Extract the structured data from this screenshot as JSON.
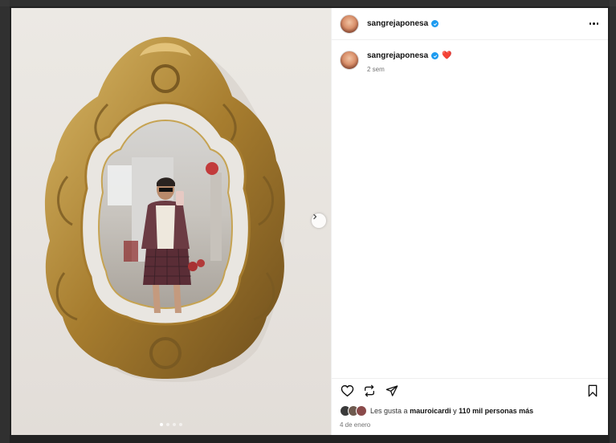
{
  "post": {
    "username": "sangrejaponesa",
    "caption_emoji": "❤️",
    "time_ago": "2 sem",
    "likes_prefix": "Les gusta a",
    "likes_user": "mauroicardi",
    "likes_conj": "y",
    "likes_count": "110 mil personas más",
    "date": "4 de enero"
  },
  "carousel": {
    "total": 4,
    "active": 1
  },
  "colors": {
    "verified": "#1d9bf0",
    "heart": "#e0245e",
    "mirror_frame": "#b08a3a"
  }
}
